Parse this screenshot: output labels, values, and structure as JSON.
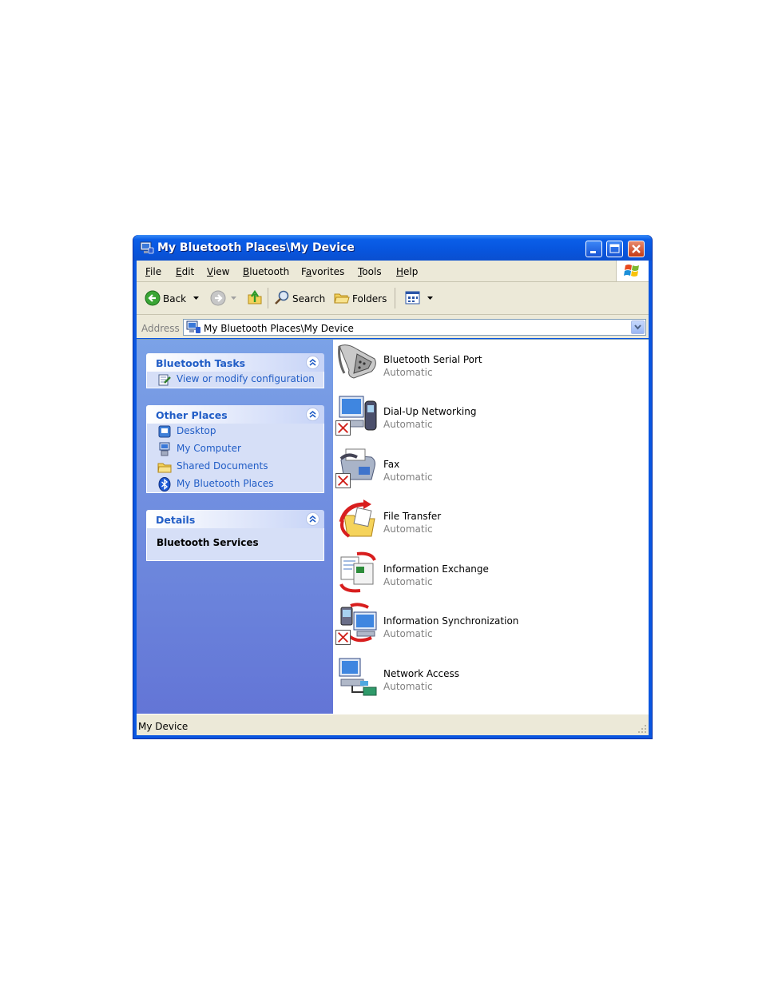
{
  "window": {
    "title": "My Bluetooth Places\\My Device",
    "colors": {
      "title_blue": "#0a56e0",
      "link_blue": "#215dc6",
      "chrome": "#ece9d8",
      "pane_blue": "#7ba2e7"
    }
  },
  "menu": {
    "items": [
      {
        "accel": "F",
        "rest": "ile"
      },
      {
        "accel": "E",
        "rest": "dit"
      },
      {
        "accel": "V",
        "rest": "iew"
      },
      {
        "accel": "B",
        "rest": "luetooth"
      },
      {
        "pre": "F",
        "accel": "a",
        "rest": "vorites"
      },
      {
        "accel": "T",
        "rest": "ools"
      },
      {
        "accel": "H",
        "rest": "elp"
      }
    ]
  },
  "toolbar": {
    "back_label": "Back",
    "search_label": "Search",
    "folders_label": "Folders"
  },
  "address": {
    "label": "Address",
    "value": "My Bluetooth Places\\My Device"
  },
  "taskpane": {
    "bluetooth_tasks": {
      "title": "Bluetooth Tasks",
      "links": [
        "View or modify configuration"
      ]
    },
    "other_places": {
      "title": "Other Places",
      "links": [
        "Desktop",
        "My Computer",
        "Shared Documents",
        "My Bluetooth Places"
      ]
    },
    "details": {
      "title": "Details",
      "text": "Bluetooth Services"
    }
  },
  "services": [
    {
      "name": "Bluetooth Serial Port",
      "status": "Automatic",
      "icon": "serial-port-icon",
      "disabled": false
    },
    {
      "name": "Dial-Up Networking",
      "status": "Automatic",
      "icon": "dial-up-icon",
      "disabled": true
    },
    {
      "name": "Fax",
      "status": "Automatic",
      "icon": "fax-icon",
      "disabled": true
    },
    {
      "name": "File Transfer",
      "status": "Automatic",
      "icon": "file-transfer-icon",
      "disabled": false
    },
    {
      "name": "Information Exchange",
      "status": "Automatic",
      "icon": "information-exchange-icon",
      "disabled": false
    },
    {
      "name": "Information Synchronization",
      "status": "Automatic",
      "icon": "information-sync-icon",
      "disabled": true
    },
    {
      "name": "Network Access",
      "status": "Automatic",
      "icon": "network-access-icon",
      "disabled": false
    }
  ],
  "statusbar": {
    "text": "My Device"
  }
}
